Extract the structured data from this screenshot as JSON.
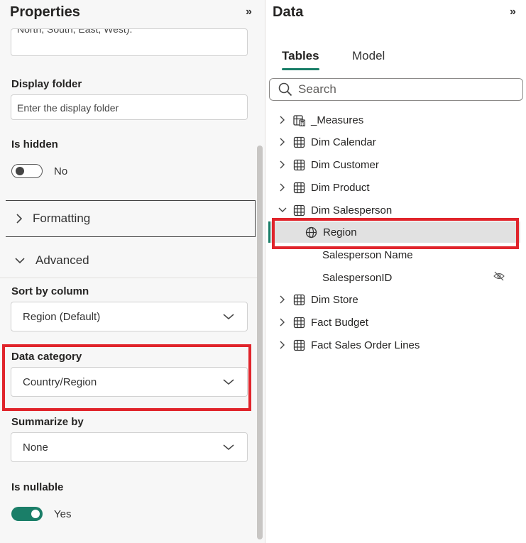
{
  "properties": {
    "title": "Properties",
    "collapse_glyph": "»",
    "description_partial": "North, South, East, West).",
    "display_folder": {
      "label": "Display folder",
      "placeholder": "Enter the display folder"
    },
    "is_hidden": {
      "label": "Is hidden",
      "state_text": "No",
      "on": false
    },
    "formatting": {
      "label": "Formatting"
    },
    "advanced": {
      "label": "Advanced"
    },
    "sort_by_column": {
      "label": "Sort by column",
      "value": "Region (Default)"
    },
    "data_category": {
      "label": "Data category",
      "value": "Country/Region"
    },
    "summarize_by": {
      "label": "Summarize by",
      "value": "None"
    },
    "is_nullable": {
      "label": "Is nullable",
      "state_text": "Yes",
      "on": true
    }
  },
  "data": {
    "title": "Data",
    "collapse_glyph": "»",
    "tabs": [
      {
        "label": "Tables",
        "active": true
      },
      {
        "label": "Model",
        "active": false
      }
    ],
    "search": {
      "placeholder": "Search"
    },
    "tree": {
      "measures": "_Measures",
      "dim_calendar": "Dim Calendar",
      "dim_customer": "Dim Customer",
      "dim_product": "Dim Product",
      "dim_salesperson": "Dim Salesperson",
      "region": "Region",
      "salesperson_name": "Salesperson Name",
      "salesperson_id": "SalespersonID",
      "dim_store": "Dim Store",
      "fact_budget": "Fact Budget",
      "fact_sales_order_lines": "Fact Sales Order Lines"
    }
  },
  "colors": {
    "accent": "#1a7e68",
    "highlight_frame": "#e0242b",
    "selected_row": "#e1e1e1"
  },
  "icons": [
    "chevron-right-icon",
    "chevron-down-icon",
    "search-icon",
    "table-icon",
    "calculator-table-icon",
    "globe-icon",
    "eye-off-icon"
  ]
}
